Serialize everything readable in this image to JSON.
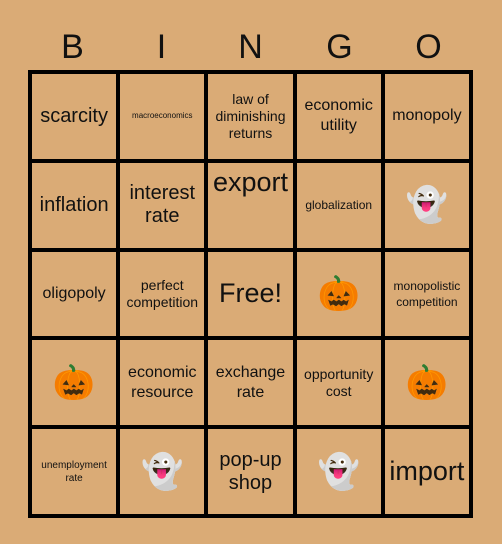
{
  "header": {
    "letters": [
      "B",
      "I",
      "N",
      "G",
      "O"
    ]
  },
  "card": {
    "rows": [
      [
        {
          "text": "scarcity",
          "type": "text",
          "size": "lg"
        },
        {
          "text": "macroeconomics",
          "type": "text",
          "size": "tiny"
        },
        {
          "text": "law of diminishing returns",
          "type": "text",
          "size": "sm"
        },
        {
          "text": "economic utility",
          "type": "text",
          "size": "md"
        },
        {
          "text": "monopoly",
          "type": "text",
          "size": "md"
        }
      ],
      [
        {
          "text": "inflation",
          "type": "text",
          "size": "lg"
        },
        {
          "text": "interest rate",
          "type": "text",
          "size": "lg"
        },
        {
          "text": "export",
          "type": "text",
          "size": "xl",
          "align": "top"
        },
        {
          "text": "globalization",
          "type": "text",
          "size": "xs"
        },
        {
          "text": "👻",
          "type": "icon",
          "icon": "ghost-icon"
        }
      ],
      [
        {
          "text": "oligopoly",
          "type": "text",
          "size": "md"
        },
        {
          "text": "perfect competition",
          "type": "text",
          "size": "sm"
        },
        {
          "text": "Free!",
          "type": "text",
          "size": "xl"
        },
        {
          "text": "🎃",
          "type": "icon",
          "icon": "pumpkin-icon"
        },
        {
          "text": "monopolistic competition",
          "type": "text",
          "size": "xs"
        }
      ],
      [
        {
          "text": "🎃",
          "type": "icon",
          "icon": "pumpkin-icon"
        },
        {
          "text": "economic resource",
          "type": "text",
          "size": "md"
        },
        {
          "text": "exchange rate",
          "type": "text",
          "size": "md"
        },
        {
          "text": "opportunity cost",
          "type": "text",
          "size": "sm"
        },
        {
          "text": "🎃",
          "type": "icon",
          "icon": "pumpkin-icon"
        }
      ],
      [
        {
          "text": "unemployment rate",
          "type": "text",
          "size": "xxs"
        },
        {
          "text": "👻",
          "type": "icon",
          "icon": "ghost-icon"
        },
        {
          "text": "pop-up shop",
          "type": "text",
          "size": "lg"
        },
        {
          "text": "👻",
          "type": "icon",
          "icon": "ghost-icon"
        },
        {
          "text": "import",
          "type": "text",
          "size": "xl"
        }
      ]
    ]
  },
  "colors": {
    "background": "#DAAB76",
    "grid_line": "#000000",
    "text": "#111111"
  }
}
